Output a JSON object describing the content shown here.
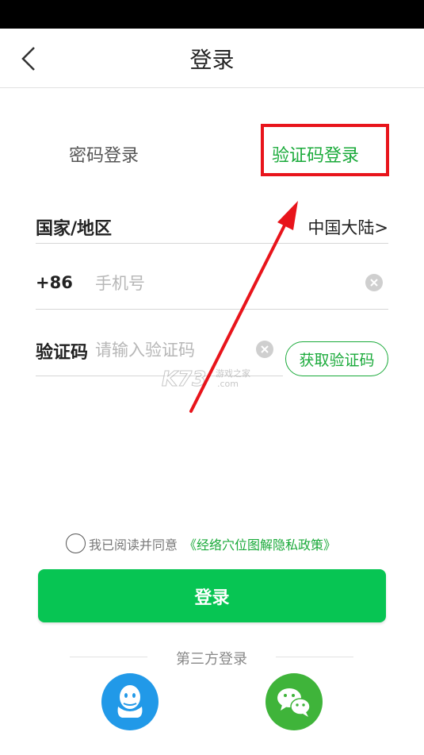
{
  "header": {
    "title": "登录"
  },
  "tabs": {
    "password_label": "密码登录",
    "code_label": "验证码登录"
  },
  "form": {
    "region_label": "国家/地区",
    "region_value": "中国大陆>",
    "country_code": "+86",
    "phone_placeholder": "手机号",
    "code_label": "验证码",
    "code_placeholder": "请输入验证码",
    "get_code_label": "获取验证码"
  },
  "agreement": {
    "text": "我已阅读并同意",
    "link": "《经络穴位图解隐私政策》"
  },
  "login_button": "登录",
  "third_party": {
    "label": "第三方登录",
    "providers": [
      "qq-icon",
      "wechat-icon"
    ]
  },
  "watermark": {
    "logo": "K73",
    "text_top": "游戏之家",
    "text_bottom": ".com"
  },
  "colors": {
    "accent_green": "#1aaa3a",
    "button_green": "#07c553",
    "highlight_red": "#e8141b",
    "qq_blue": "#2199e8",
    "wechat_green": "#3fb43a"
  }
}
